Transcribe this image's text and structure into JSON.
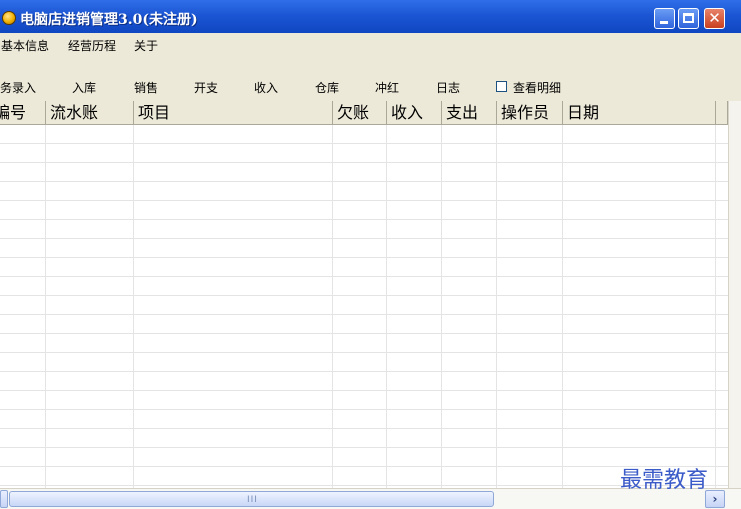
{
  "window": {
    "title": "电脑店进销管理3.0(未注册)",
    "controls": {
      "minimize": "minimize",
      "maximize": "maximize",
      "close": "✕"
    }
  },
  "menubar": {
    "items": [
      "基本信息",
      "经营历程",
      "关于"
    ]
  },
  "toolbar": {
    "items": [
      "业务录入",
      "入库",
      "销售",
      "开支",
      "收入",
      "仓库",
      "冲红",
      "日志"
    ],
    "checkbox_label": "查看明细",
    "checkbox_checked": false
  },
  "grid": {
    "columns": [
      "编号",
      "流水账",
      "项目",
      "欠账",
      "收入",
      "支出",
      "操作员",
      "日期"
    ],
    "rows": []
  },
  "scrollbar": {
    "grip": "III",
    "right_arrow": "›"
  },
  "watermark": "最需教育",
  "colors": {
    "titlebar": "#1c56d4",
    "chrome": "#ece9d8",
    "close_button": "#c9401f",
    "watermark": "#3b5bc9"
  }
}
